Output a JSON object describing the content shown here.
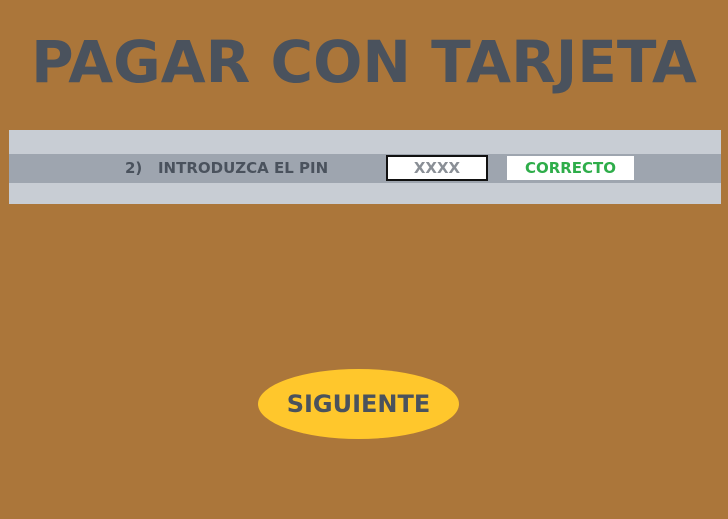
{
  "page": {
    "title": "PAGAR CON TARJETA"
  },
  "pin_step": {
    "label": "2)   INTRODUZCA EL PIN",
    "pin_value": "XXXX",
    "status": "CORRECTO"
  },
  "actions": {
    "next_label": "SIGUIENTE"
  },
  "colors": {
    "background": "#AB763A",
    "title_text": "#4A525D",
    "panel": "#C8CDD4",
    "row": "#9EA5AF",
    "status_text": "#2EAD4A",
    "button": "#FFC72C"
  }
}
